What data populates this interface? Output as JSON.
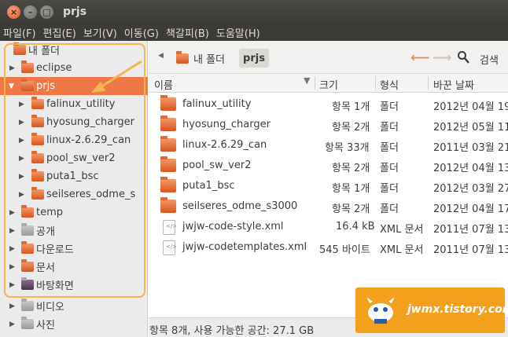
{
  "window": {
    "title": "prjs"
  },
  "menu": [
    "파일(F)",
    "편집(E)",
    "보기(V)",
    "이동(G)",
    "책갈피(B)",
    "도움말(H)"
  ],
  "sidebar": {
    "items": [
      {
        "label": "내 폴더",
        "icon": "home-folder-icon",
        "expander": ""
      },
      {
        "label": "eclipse",
        "icon": "folder-icon",
        "expander": "▶"
      },
      {
        "label": "prjs",
        "icon": "folder-icon",
        "expander": "▼",
        "selected": true
      },
      {
        "label": "falinux_utility",
        "icon": "folder-icon",
        "expander": "▶"
      },
      {
        "label": "hyosung_charger",
        "icon": "folder-icon",
        "expander": "▶"
      },
      {
        "label": "linux-2.6.29_can",
        "icon": "folder-icon",
        "expander": "▶"
      },
      {
        "label": "pool_sw_ver2",
        "icon": "folder-icon",
        "expander": "▶"
      },
      {
        "label": "puta1_bsc",
        "icon": "folder-icon",
        "expander": "▶"
      },
      {
        "label": "seilseres_odme_s",
        "icon": "folder-icon",
        "expander": "▶"
      },
      {
        "label": "temp",
        "icon": "folder-icon",
        "expander": "▶"
      },
      {
        "label": "공개",
        "icon": "public-folder-icon",
        "expander": "▶"
      },
      {
        "label": "다운로드",
        "icon": "download-folder-icon",
        "expander": "▶"
      },
      {
        "label": "문서",
        "icon": "documents-folder-icon",
        "expander": "▶"
      },
      {
        "label": "바탕화면",
        "icon": "desktop-folder-icon",
        "expander": "▶"
      },
      {
        "label": "비디오",
        "icon": "videos-folder-icon",
        "expander": "▶"
      },
      {
        "label": "사진",
        "icon": "pictures-folder-icon",
        "expander": "▶"
      }
    ]
  },
  "pathbar": {
    "home_label": "내 폴더",
    "current": "prjs",
    "search_label": "검색"
  },
  "columns": {
    "name": "이름",
    "size": "크기",
    "type": "형식",
    "modified": "바꾼 날짜"
  },
  "files": [
    {
      "name": "falinux_utility",
      "size": "항목 1개",
      "type": "폴더",
      "modified": "2012년 04월 19",
      "icon": "folder-icon"
    },
    {
      "name": "hyosung_charger",
      "size": "항목 2개",
      "type": "폴더",
      "modified": "2012년 05월 11",
      "icon": "folder-icon"
    },
    {
      "name": "linux-2.6.29_can",
      "size": "항목 33개",
      "type": "폴더",
      "modified": "2011년 03월 21",
      "icon": "folder-icon"
    },
    {
      "name": "pool_sw_ver2",
      "size": "항목 2개",
      "type": "폴더",
      "modified": "2012년 04월 13",
      "icon": "folder-icon"
    },
    {
      "name": "puta1_bsc",
      "size": "항목 1개",
      "type": "폴더",
      "modified": "2012년 03월 27",
      "icon": "folder-icon"
    },
    {
      "name": "seilseres_odme_s3000",
      "size": "항목 2개",
      "type": "폴더",
      "modified": "2012년 04월 17",
      "icon": "folder-icon"
    },
    {
      "name": "jwjw-code-style.xml",
      "size": "16.4 kB",
      "type": "XML 문서",
      "modified": "2011년 07월 13",
      "icon": "xml-file-icon"
    },
    {
      "name": "jwjw-codetemplates.xml",
      "size": "545 바이트",
      "type": "XML 문서",
      "modified": "2011년 07월 13",
      "icon": "xml-file-icon"
    }
  ],
  "status": "항목 8개, 사용 가능한 공간: 27.1 GB",
  "watermark": {
    "text": "jwmx.tistory.com"
  },
  "colors": {
    "accent": "#f07746",
    "titlebar": "#3c3b37",
    "highlight": "#f2b654",
    "badge": "#f2a01e"
  }
}
